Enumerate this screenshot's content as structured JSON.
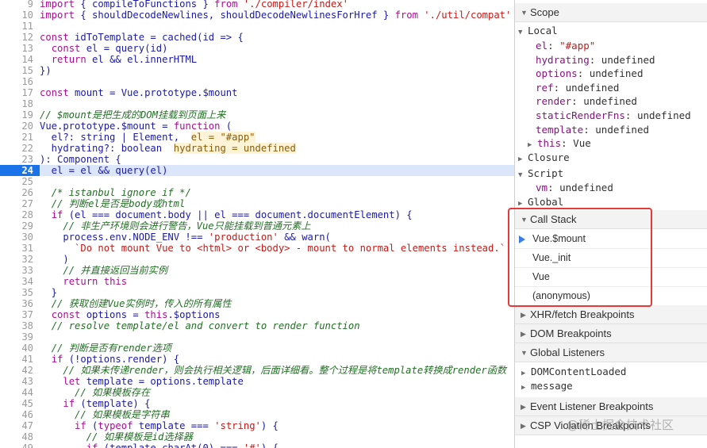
{
  "code_lines": [
    {
      "n": "9",
      "tokens": [
        [
          "kw",
          "import"
        ],
        [
          "plain",
          " { compileToFunctions } "
        ],
        [
          "kw",
          "from"
        ],
        [
          "plain",
          " "
        ],
        [
          "str",
          "'./compiler/index'"
        ]
      ]
    },
    {
      "n": "10",
      "tokens": [
        [
          "kw",
          "import"
        ],
        [
          "plain",
          " { shouldDecodeNewlines, shouldDecodeNewlinesForHref } "
        ],
        [
          "kw",
          "from"
        ],
        [
          "plain",
          " "
        ],
        [
          "str",
          "'./util/compat'"
        ]
      ]
    },
    {
      "n": "11",
      "tokens": []
    },
    {
      "n": "12",
      "tokens": [
        [
          "kw",
          "const"
        ],
        [
          "plain",
          " idToTemplate = cached(id => {"
        ]
      ]
    },
    {
      "n": "13",
      "tokens": [
        [
          "plain",
          "  "
        ],
        [
          "kw",
          "const"
        ],
        [
          "plain",
          " el = query(id)"
        ]
      ]
    },
    {
      "n": "14",
      "tokens": [
        [
          "plain",
          "  "
        ],
        [
          "kw",
          "return"
        ],
        [
          "plain",
          " el && el.innerHTML"
        ]
      ]
    },
    {
      "n": "15",
      "tokens": [
        [
          "plain",
          "})"
        ]
      ]
    },
    {
      "n": "16",
      "tokens": []
    },
    {
      "n": "17",
      "tokens": [
        [
          "kw",
          "const"
        ],
        [
          "plain",
          " mount = Vue.prototype.$mount"
        ]
      ]
    },
    {
      "n": "18",
      "tokens": []
    },
    {
      "n": "19",
      "tokens": [
        [
          "cmt",
          "// $mount是把生成的DOM挂载到页面上来"
        ]
      ]
    },
    {
      "n": "20",
      "tokens": [
        [
          "plain",
          "Vue.prototype.$mount = "
        ],
        [
          "kw",
          "function"
        ],
        [
          "plain",
          " ("
        ]
      ]
    },
    {
      "n": "21",
      "tokens": [
        [
          "plain",
          "  el?: string | Element,  "
        ],
        [
          "inline-val",
          "el = \"#app\""
        ]
      ]
    },
    {
      "n": "22",
      "tokens": [
        [
          "plain",
          "  hydrating?: boolean  "
        ],
        [
          "inline-val",
          "hydrating = undefined"
        ]
      ]
    },
    {
      "n": "23",
      "tokens": [
        [
          "plain",
          "): Component {"
        ]
      ]
    },
    {
      "n": "24",
      "tokens": [
        [
          "plain",
          "  el = el && query(el)"
        ]
      ],
      "current": true
    },
    {
      "n": "25",
      "tokens": []
    },
    {
      "n": "26",
      "tokens": [
        [
          "plain",
          "  "
        ],
        [
          "cmt",
          "/* istanbul ignore if */"
        ]
      ]
    },
    {
      "n": "27",
      "tokens": [
        [
          "plain",
          "  "
        ],
        [
          "cmt",
          "// 判断el是否是body或html"
        ]
      ]
    },
    {
      "n": "28",
      "tokens": [
        [
          "plain",
          "  "
        ],
        [
          "kw",
          "if"
        ],
        [
          "plain",
          " (el === document.body || el === document.documentElement) {"
        ]
      ]
    },
    {
      "n": "29",
      "tokens": [
        [
          "plain",
          "    "
        ],
        [
          "cmt",
          "// 非生产环境则会进行警告，Vue只能挂载到普通元素上"
        ]
      ]
    },
    {
      "n": "30",
      "tokens": [
        [
          "plain",
          "    process.env.NODE_ENV !== "
        ],
        [
          "str",
          "'production'"
        ],
        [
          "plain",
          " && warn("
        ]
      ]
    },
    {
      "n": "31",
      "tokens": [
        [
          "plain",
          "      "
        ],
        [
          "str",
          "`Do not mount Vue to <html> or <body> - mount to normal elements instead.`"
        ]
      ]
    },
    {
      "n": "32",
      "tokens": [
        [
          "plain",
          "    )"
        ]
      ]
    },
    {
      "n": "33",
      "tokens": [
        [
          "plain",
          "    "
        ],
        [
          "cmt",
          "// 并直接返回当前实例"
        ]
      ]
    },
    {
      "n": "34",
      "tokens": [
        [
          "plain",
          "    "
        ],
        [
          "kw",
          "return"
        ],
        [
          "plain",
          " "
        ],
        [
          "kw",
          "this"
        ]
      ]
    },
    {
      "n": "35",
      "tokens": [
        [
          "plain",
          "  }"
        ]
      ]
    },
    {
      "n": "36",
      "tokens": [
        [
          "plain",
          "  "
        ],
        [
          "cmt",
          "// 获取创建Vue实例时，传入的所有属性"
        ]
      ]
    },
    {
      "n": "37",
      "tokens": [
        [
          "plain",
          "  "
        ],
        [
          "kw",
          "const"
        ],
        [
          "plain",
          " options = "
        ],
        [
          "kw",
          "this"
        ],
        [
          "plain",
          ".$options"
        ]
      ]
    },
    {
      "n": "38",
      "tokens": [
        [
          "plain",
          "  "
        ],
        [
          "cmt",
          "// resolve template/el and convert to render function"
        ]
      ]
    },
    {
      "n": "39",
      "tokens": []
    },
    {
      "n": "40",
      "tokens": [
        [
          "plain",
          "  "
        ],
        [
          "cmt",
          "// 判断是否有render选项"
        ]
      ]
    },
    {
      "n": "41",
      "tokens": [
        [
          "plain",
          "  "
        ],
        [
          "kw",
          "if"
        ],
        [
          "plain",
          " (!options.render) {"
        ]
      ]
    },
    {
      "n": "42",
      "tokens": [
        [
          "plain",
          "    "
        ],
        [
          "cmt",
          "// 如果未传递render，则会执行相关逻辑，后面详细看。整个过程是将template转换成render函数"
        ]
      ]
    },
    {
      "n": "43",
      "tokens": [
        [
          "plain",
          "    "
        ],
        [
          "kw",
          "let"
        ],
        [
          "plain",
          " template = options.template"
        ]
      ]
    },
    {
      "n": "44",
      "tokens": [
        [
          "plain",
          "      "
        ],
        [
          "cmt",
          "// 如果模板存在"
        ]
      ]
    },
    {
      "n": "45",
      "tokens": [
        [
          "plain",
          "    "
        ],
        [
          "kw",
          "if"
        ],
        [
          "plain",
          " (template) {"
        ]
      ]
    },
    {
      "n": "46",
      "tokens": [
        [
          "plain",
          "      "
        ],
        [
          "cmt",
          "// 如果模板是字符串"
        ]
      ]
    },
    {
      "n": "47",
      "tokens": [
        [
          "plain",
          "      "
        ],
        [
          "kw",
          "if"
        ],
        [
          "plain",
          " ("
        ],
        [
          "kw",
          "typeof"
        ],
        [
          "plain",
          " template === "
        ],
        [
          "str",
          "'string'"
        ],
        [
          "plain",
          ") {"
        ]
      ]
    },
    {
      "n": "48",
      "tokens": [
        [
          "plain",
          "        "
        ],
        [
          "cmt",
          "// 如果模板是id选择器"
        ]
      ]
    },
    {
      "n": "49",
      "tokens": [
        [
          "plain",
          "        "
        ],
        [
          "kw",
          "if"
        ],
        [
          "plain",
          " (template.charAt(0) === "
        ],
        [
          "str",
          "'#'"
        ],
        [
          "plain",
          ") {"
        ]
      ]
    }
  ],
  "panel": {
    "scope_title": "Scope",
    "local_title": "Local",
    "local_vars": [
      {
        "key": "el",
        "val": "\"#app\"",
        "is_str": true
      },
      {
        "key": "hydrating",
        "val": "undefined"
      },
      {
        "key": "options",
        "val": "undefined"
      },
      {
        "key": "ref",
        "val": "undefined"
      },
      {
        "key": "render",
        "val": "undefined"
      },
      {
        "key": "staticRenderFns",
        "val": "undefined"
      },
      {
        "key": "template",
        "val": "undefined"
      }
    ],
    "this_key": "this",
    "this_val": "Vue",
    "closure_title": "Closure",
    "script_title": "Script",
    "script_var": {
      "key": "vm",
      "val": "undefined"
    },
    "global_title": "Global",
    "call_stack_title": "Call Stack",
    "call_stack": [
      "Vue.$mount",
      "Vue._init",
      "Vue",
      "(anonymous)"
    ],
    "xhr_title": "XHR/fetch Breakpoints",
    "dom_title": "DOM Breakpoints",
    "global_listeners_title": "Global Listeners",
    "listeners": [
      "DOMContentLoaded",
      "message"
    ],
    "event_listener_title": "Event Listener Breakpoints",
    "csp_title": "CSP Violation Breakpoints"
  },
  "watermark": "@稀土掘金技术社区",
  "colors": {
    "highlight_box": "#e53a3a",
    "current_line": "#1a73e8",
    "call_frame_arrow": "#3b7ce8"
  }
}
